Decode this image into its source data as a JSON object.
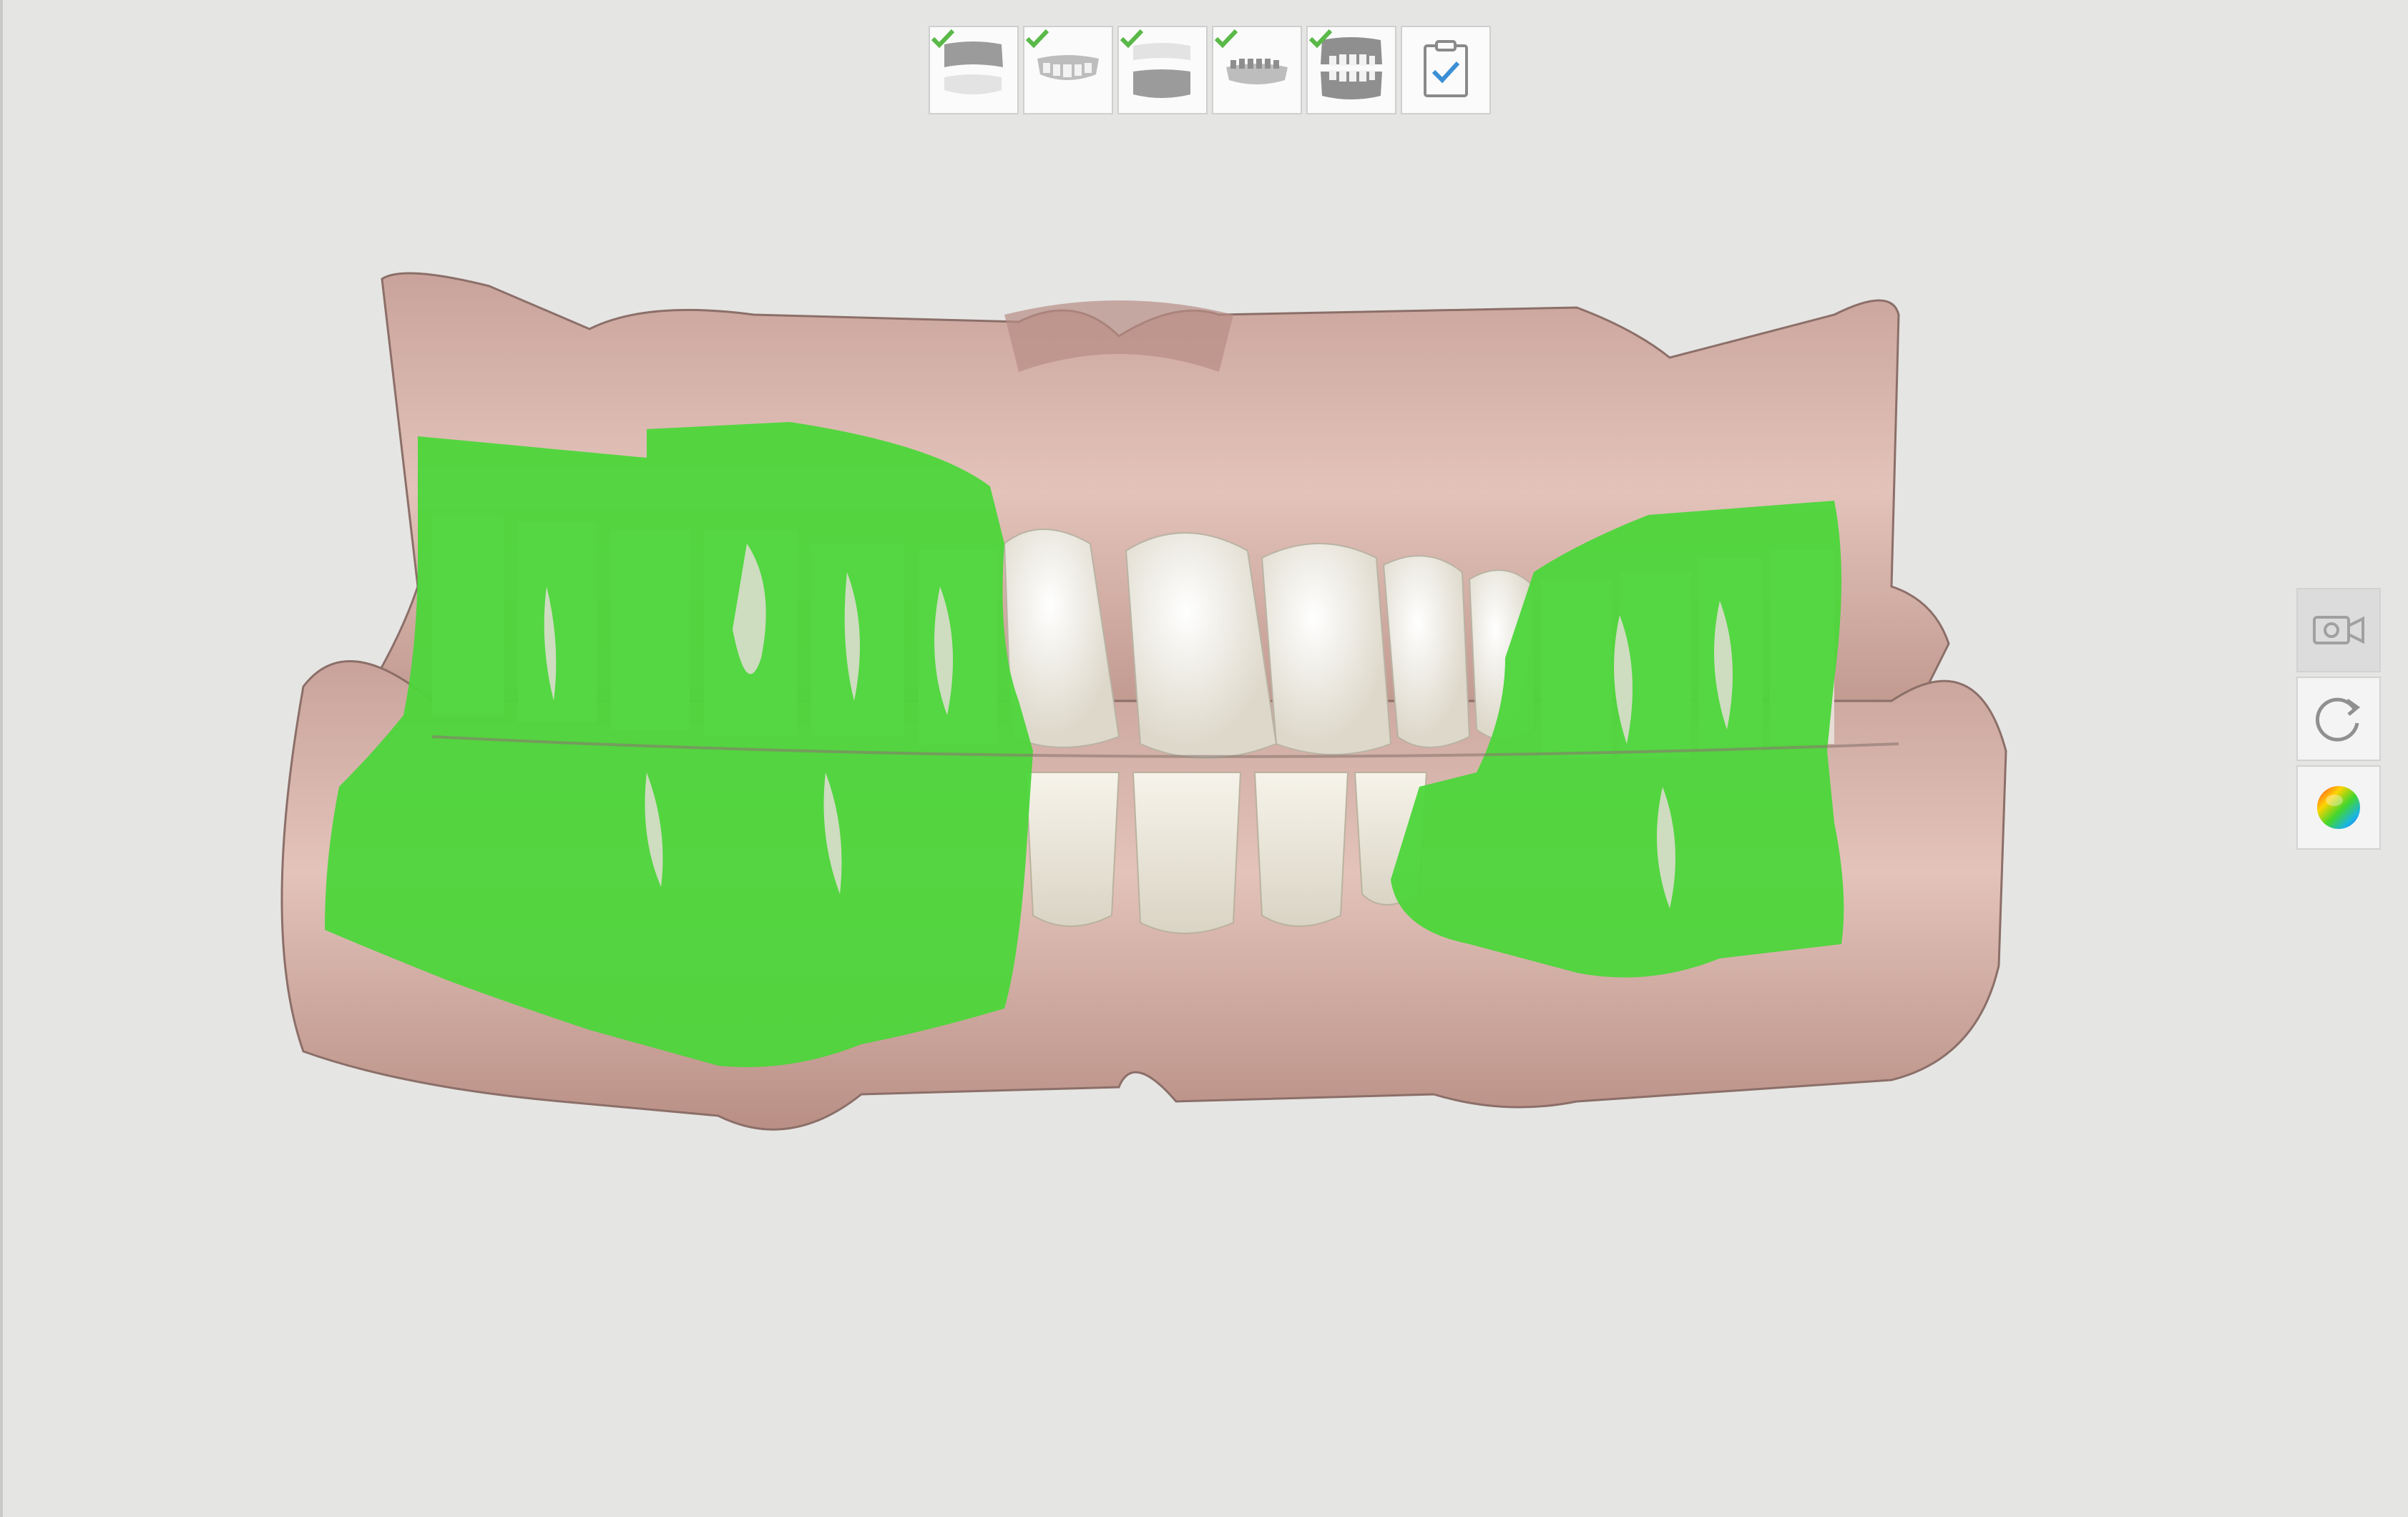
{
  "app": {
    "background_color": "#e5e5e4"
  },
  "stepbar": {
    "steps": [
      {
        "name": "maxilla-scan",
        "icon": "upper-jaw-icon",
        "completed": true
      },
      {
        "name": "maxilla-dentition",
        "icon": "upper-teeth-icon",
        "completed": true
      },
      {
        "name": "mandible-scan",
        "icon": "lower-jaw-icon",
        "completed": true
      },
      {
        "name": "mandible-dentition",
        "icon": "lower-teeth-icon",
        "completed": true
      },
      {
        "name": "occlusion",
        "icon": "occlusion-icon",
        "completed": true
      },
      {
        "name": "review",
        "icon": "clipboard-check-icon",
        "completed": false
      }
    ],
    "check_color": "#5ab948"
  },
  "tools": {
    "items": [
      {
        "name": "video-camera",
        "icon": "video-camera-icon",
        "active": true
      },
      {
        "name": "reset-view",
        "icon": "rotate-icon",
        "active": false
      },
      {
        "name": "color-map",
        "icon": "color-ball-icon",
        "active": false
      }
    ]
  },
  "viewport": {
    "gum_color": "#d9b3aa",
    "tooth_color": "#ece8dc",
    "overlay_color": "#4cd63a"
  }
}
